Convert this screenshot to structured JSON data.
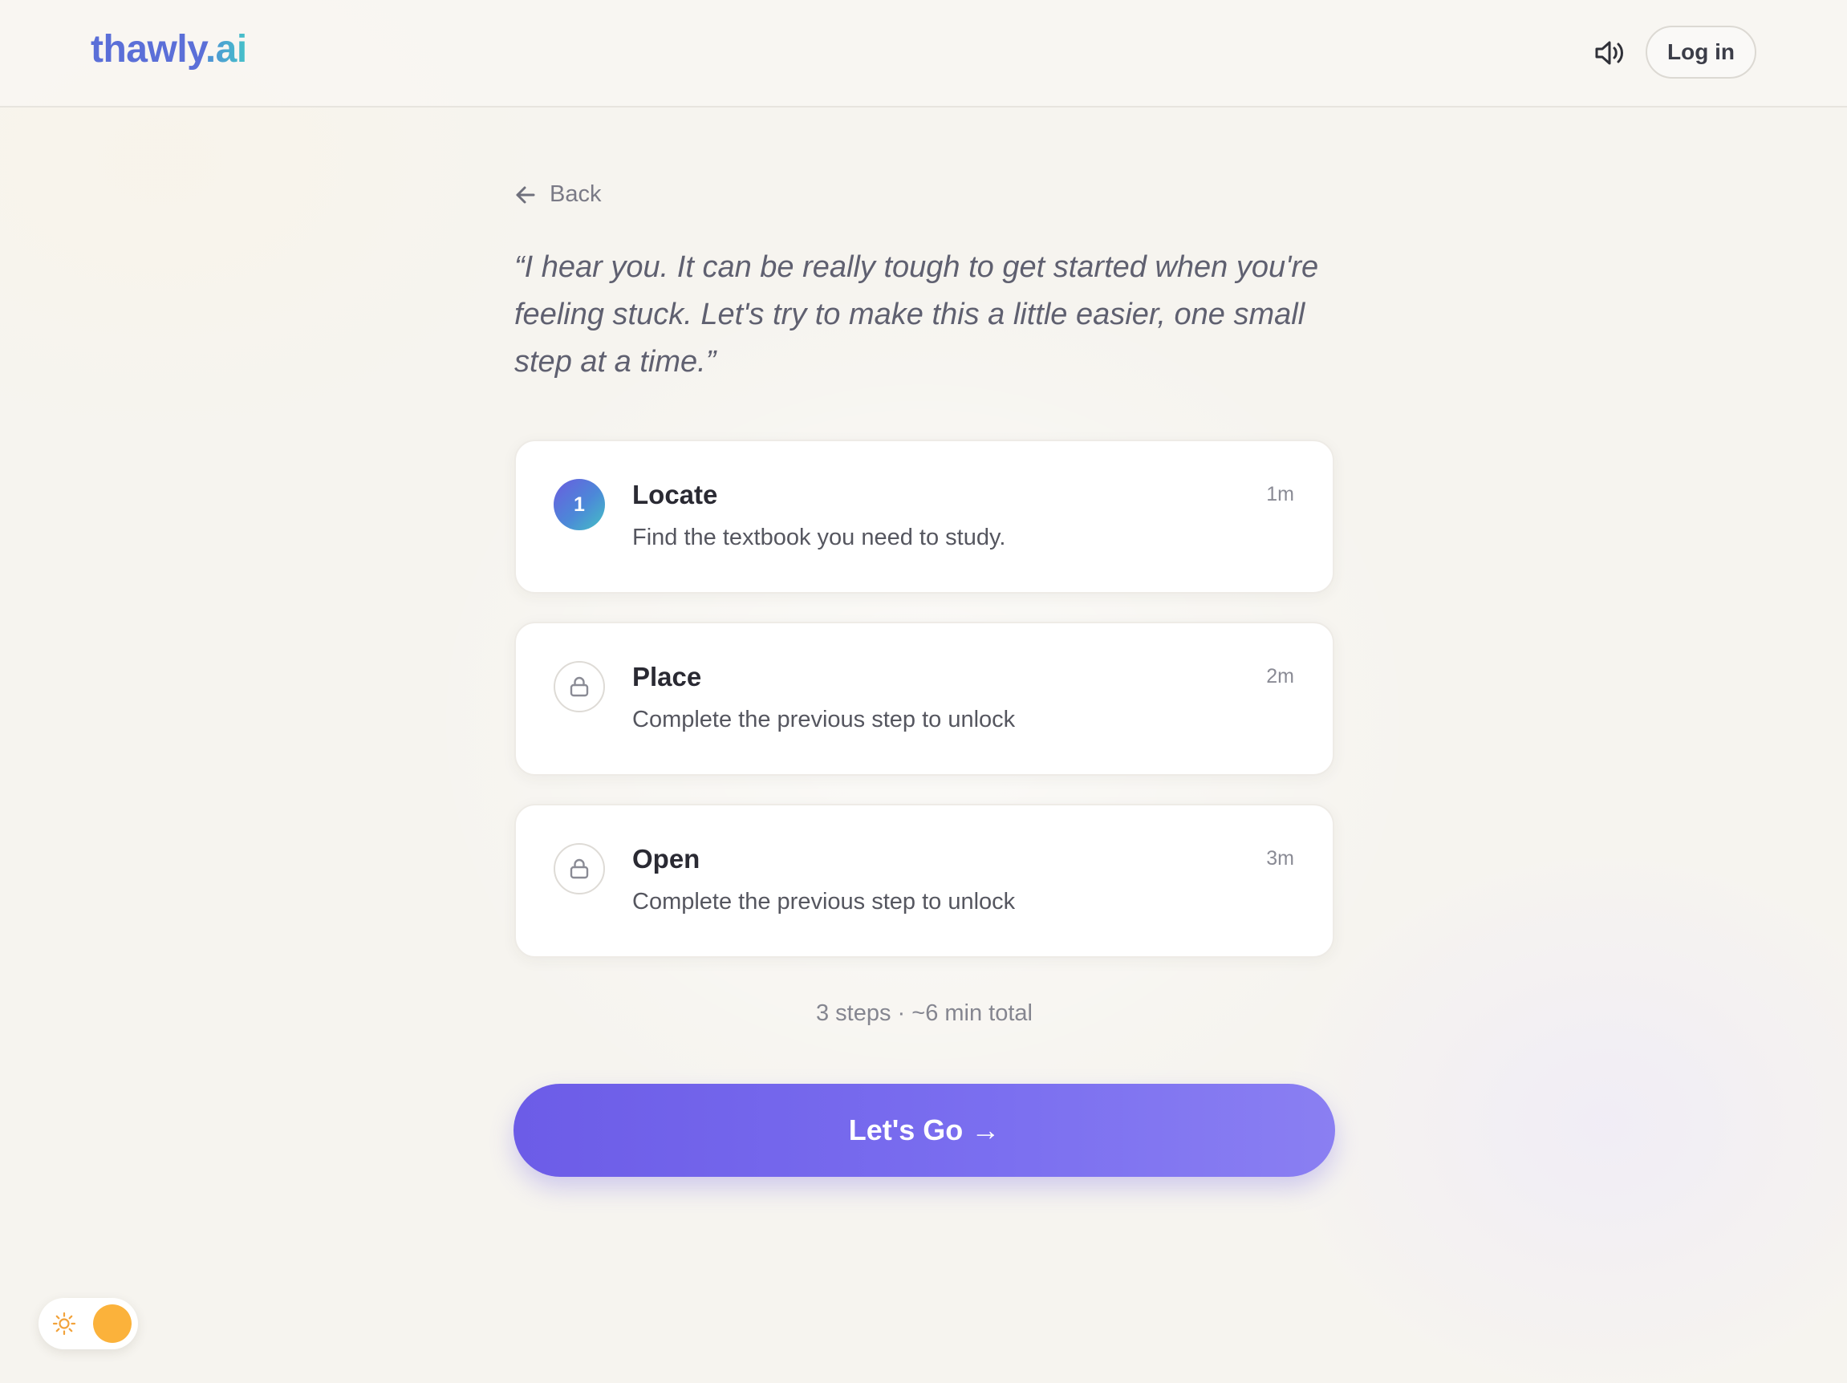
{
  "header": {
    "logo_name": "thawly",
    "logo_tld": ".ai",
    "sound_icon": "speaker-volume-icon",
    "login_label": "Log in"
  },
  "back_label": "Back",
  "quote": "“I hear you. It can be really tough to get started when you're feeling stuck. Let's try to make this a little easier, one small step at a time.”",
  "steps": [
    {
      "badge": "1",
      "status": "active",
      "title": "Locate",
      "description": "Find the textbook you need to study.",
      "duration": "1m"
    },
    {
      "badge": "",
      "status": "locked",
      "icon": "lock-icon",
      "title": "Place",
      "description": "Complete the previous step to unlock",
      "duration": "2m"
    },
    {
      "badge": "",
      "status": "locked",
      "icon": "lock-icon",
      "title": "Open",
      "description": "Complete the previous step to unlock",
      "duration": "3m"
    }
  ],
  "summary": "3 steps · ~6 min total",
  "cta_label": "Let's Go →",
  "theme_toggle": {
    "icon": "sun-icon",
    "mode": "light"
  },
  "colors": {
    "accent": "#6c5ce7",
    "logo_blue": "#5b6fd8",
    "logo_teal": "#46c2c9",
    "toggle_knob": "#fbb23b"
  }
}
